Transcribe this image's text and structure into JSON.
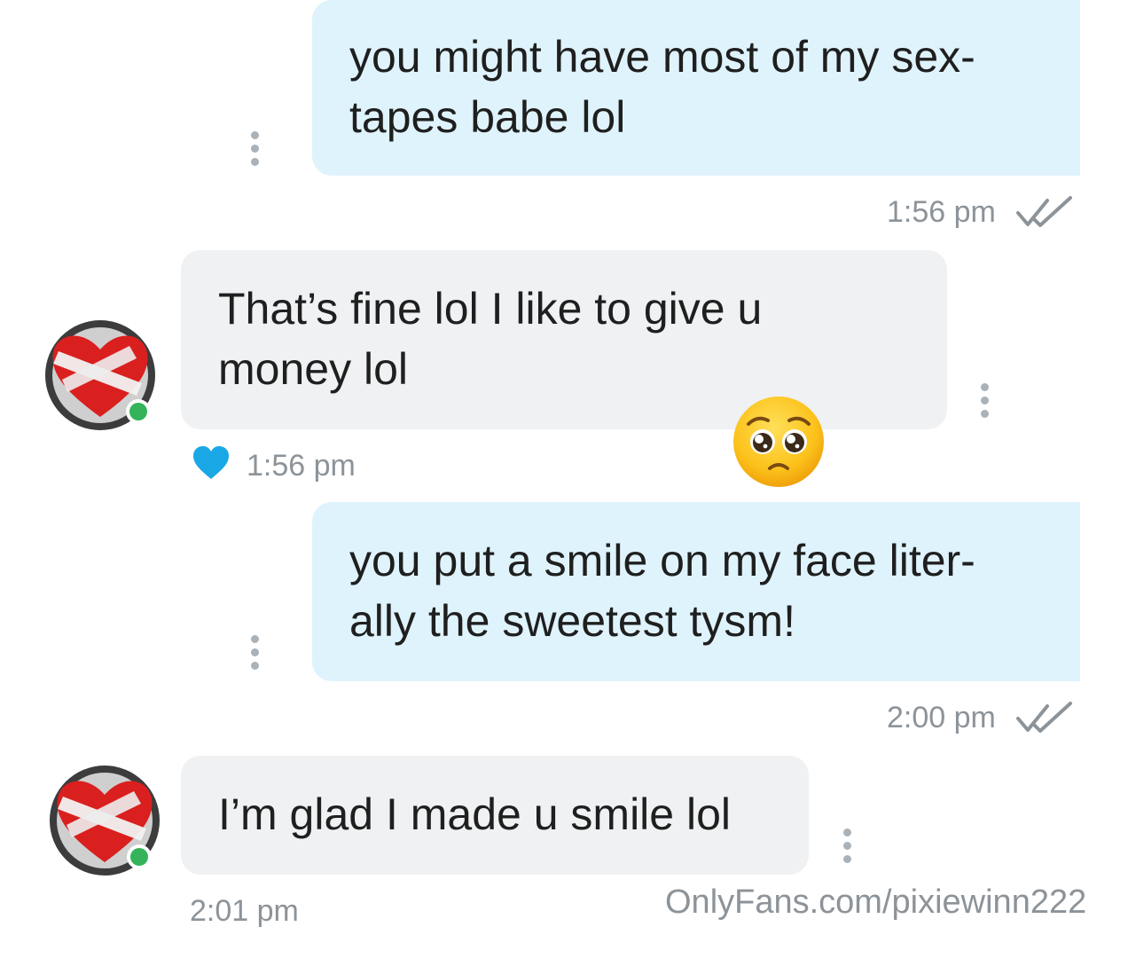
{
  "messages": [
    {
      "direction": "sent",
      "lines": [
        "you might have most of my sex-",
        "tapes babe lol"
      ],
      "time": "1:56 pm",
      "status_icon": "double-check-icon"
    },
    {
      "direction": "received",
      "lines": [
        "That’s fine lol I like to give u",
        "money lol"
      ],
      "time": "1:56 pm",
      "liked": true,
      "reaction_emoji": "pleading-face"
    },
    {
      "direction": "sent",
      "lines": [
        "you put a smile on my face liter-",
        "ally the sweetest tysm!"
      ],
      "time": "2:00 pm",
      "status_icon": "double-check-icon"
    },
    {
      "direction": "received",
      "lines": [
        "I’m glad I made u smile lol"
      ],
      "time": "2:01 pm"
    }
  ],
  "watermark": "OnlyFans.com/pixiewinn222",
  "colors": {
    "sent_bubble": "#dff3fc",
    "received_bubble": "#eff1f2",
    "online_dot": "#34b35a",
    "like_heart": "#1aa7e6",
    "meta_text": "#8c9399"
  }
}
